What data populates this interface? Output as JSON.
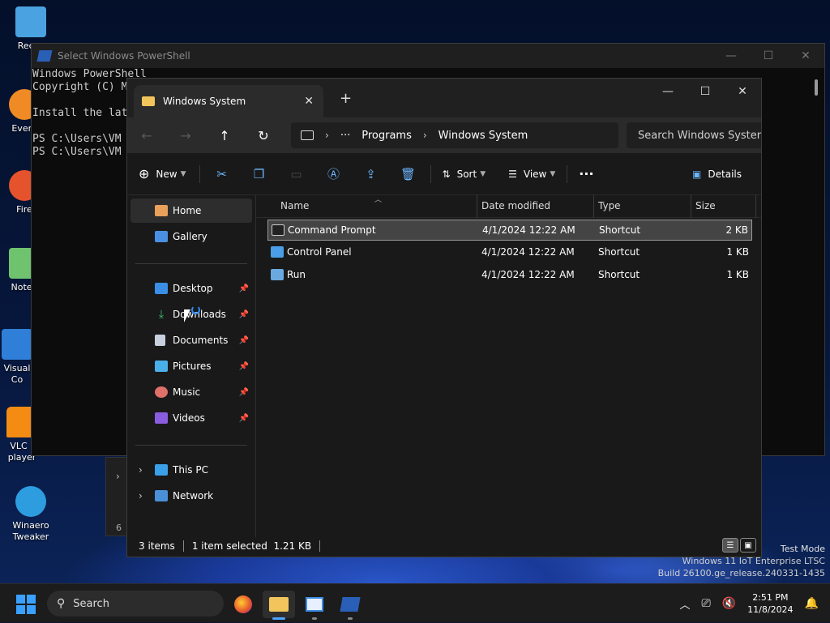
{
  "desktop": {
    "icons": [
      {
        "label": "Recyc",
        "color": "#4aa3e0"
      },
      {
        "label": "Every",
        "color": "#f08a24"
      },
      {
        "label": "Fire",
        "color": "#e5532d"
      },
      {
        "label": "Notep",
        "color": "#6fc36f"
      },
      {
        "label": "Visual Co",
        "color": "#2f7fd8"
      },
      {
        "label": "VLC r player",
        "color": "#f48b12"
      },
      {
        "label": "Winaero Tweaker",
        "color": "#2e9de0"
      }
    ]
  },
  "powershell": {
    "title": "Select Windows PowerShell",
    "lines": [
      "Windows PowerShell",
      "Copyright (C) M",
      "",
      "Install the lat",
      "",
      "PS C:\\Users\\VM",
      "PS C:\\Users\\VM"
    ]
  },
  "bg_window": {
    "partial_text": "6"
  },
  "explorer": {
    "tab_title": "Windows System",
    "address": {
      "segments": [
        "Programs",
        "Windows System"
      ],
      "overflow": "···"
    },
    "search_placeholder": "Search Windows System",
    "toolbar": {
      "new_label": "New",
      "sort_label": "Sort",
      "view_label": "View",
      "more_label": "···",
      "details_label": "Details"
    },
    "sidebar": {
      "home": "Home",
      "gallery": "Gallery",
      "quick_access": [
        {
          "label": "Desktop",
          "color": "#3a8ee6"
        },
        {
          "label": "Downloads",
          "color": "#3fbf6f"
        },
        {
          "label": "Documents",
          "color": "#c7d0dc"
        },
        {
          "label": "Pictures",
          "color": "#4ab0e8"
        },
        {
          "label": "Music",
          "color": "#e0706a"
        },
        {
          "label": "Videos",
          "color": "#8a5ce0"
        }
      ],
      "this_pc": "This PC",
      "network": "Network"
    },
    "columns": {
      "name": "Name",
      "date": "Date modified",
      "type": "Type",
      "size": "Size"
    },
    "files": [
      {
        "name": "Command Prompt",
        "date": "4/1/2024 12:22 AM",
        "type": "Shortcut",
        "size": "2 KB"
      },
      {
        "name": "Control Panel",
        "date": "4/1/2024 12:22 AM",
        "type": "Shortcut",
        "size": "1 KB"
      },
      {
        "name": "Run",
        "date": "4/1/2024 12:22 AM",
        "type": "Shortcut",
        "size": "1 KB"
      }
    ],
    "status": {
      "items": "3 items",
      "selected": "1 item selected  1.21 KB"
    }
  },
  "watermark": {
    "line1": "Test Mode",
    "line2": "Windows 11 IoT Enterprise LTSC",
    "line3": "Build 26100.ge_release.240331-1435"
  },
  "taskbar": {
    "search_placeholder": "Search",
    "time": "2:51 PM",
    "date": "11/8/2024"
  },
  "colors": {
    "accent": "#4aa3ff",
    "folder": "#f2c55c"
  }
}
